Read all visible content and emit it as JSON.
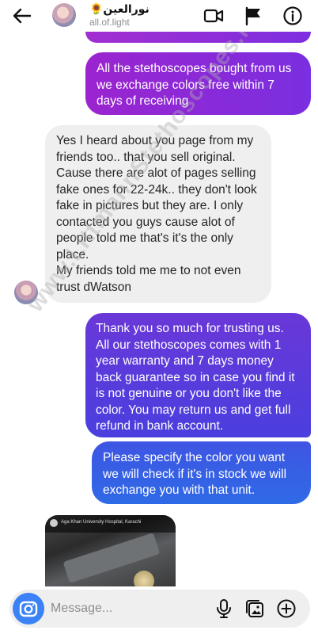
{
  "header": {
    "name": "نورالعین🌻",
    "username": "all.of.light"
  },
  "messages": [
    {
      "direction": "outgoing",
      "text": "All the stethoscopes bought from us we exchange colors free within 7 days of receiving"
    },
    {
      "direction": "incoming",
      "text": "Yes I heard about you page from my friends too.. that you sell original. Cause there are alot of pages selling fake ones for 22-24k.. they don't look fake in pictures but they are. I only contacted you guys cause alot of people told me that's it's the only place.\nMy friends told me me to not even trust dWatson"
    },
    {
      "direction": "outgoing",
      "text": "Thank you so much for trusting us. All our stethoscopes comes with 1 year warranty and 7 days money back guarantee so in case you find it is not genuine or you don't like the color. You may return us and get full refund in bank account."
    },
    {
      "direction": "outgoing",
      "text": "Please specify the color you want we will check if it's in stock we will exchange you with that unit."
    }
  ],
  "media_preview": {
    "caption": "Aga Khan University Hospital, Karachi"
  },
  "watermark": "www.LittmannStethoscopes.PK",
  "composer": {
    "placeholder": "Message..."
  },
  "colors": {
    "outgoing_purple": "#8e2bd8",
    "outgoing_blue": "#3a5ee4",
    "incoming_gray": "#efefef",
    "camera_blue": "#3b82f6"
  }
}
